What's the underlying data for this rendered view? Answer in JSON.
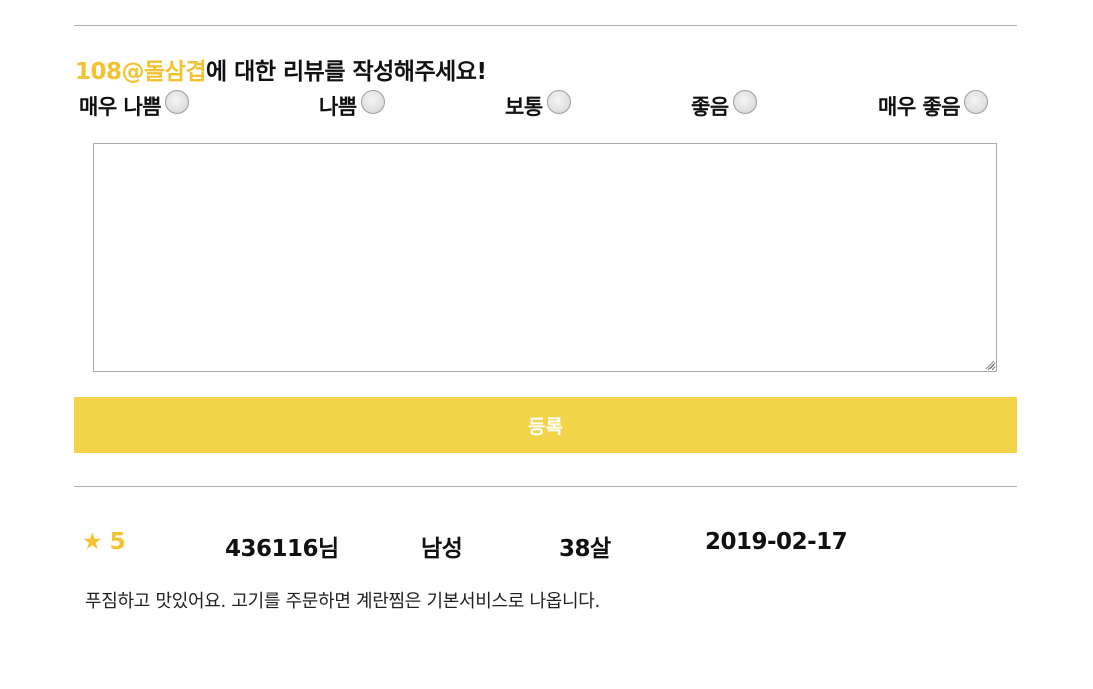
{
  "form": {
    "store_name": "108@돌삼겹",
    "heading_suffix": "에 대한 리뷰를 작성해주세요!",
    "rating_options": [
      {
        "label": "매우 나쁨"
      },
      {
        "label": "나쁨"
      },
      {
        "label": "보통"
      },
      {
        "label": "좋음"
      },
      {
        "label": "매우 좋음"
      }
    ],
    "textarea_value": "",
    "submit_label": "등록"
  },
  "review": {
    "star_glyph": "★",
    "score": "5",
    "user": "436116님",
    "gender": "남성",
    "age": "38살",
    "date": "2019-02-17",
    "content": "푸짐하고 맛있어요. 고기를 주문하면 계란찜은 기본서비스로 나옵니다."
  },
  "colors": {
    "accent": "#f2c230",
    "button_bg": "#f3d347",
    "divider": "#b3b3b3"
  }
}
